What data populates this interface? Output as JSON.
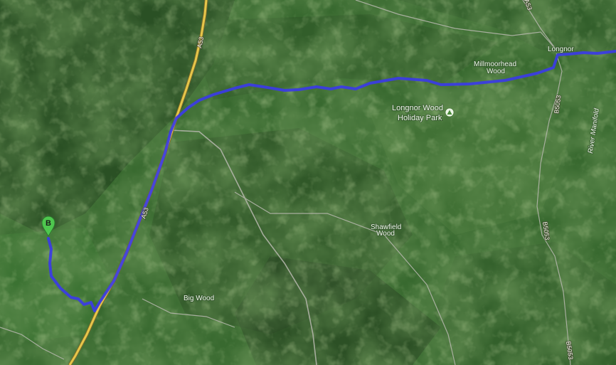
{
  "map": {
    "type": "satellite",
    "route_color": "#3b3be6",
    "marker_color": "#4ec74e",
    "places": [
      {
        "name": "Longnor",
        "kind": "village"
      },
      {
        "name": "Millmoorhead",
        "kind": "wood"
      },
      {
        "name": "Wood",
        "kind": "wood"
      },
      {
        "name": "Longnor Wood",
        "kind": "poi"
      },
      {
        "name": "Holiday Park",
        "kind": "poi"
      },
      {
        "name": "Shawfield",
        "kind": "wood"
      },
      {
        "name": "Big Wood",
        "kind": "wood"
      },
      {
        "name": "River Manifold",
        "kind": "river"
      }
    ],
    "roads": {
      "a53": "A53",
      "b5053": "B5053"
    },
    "marker": {
      "label": "B"
    },
    "poi_icon": "campground-icon"
  }
}
